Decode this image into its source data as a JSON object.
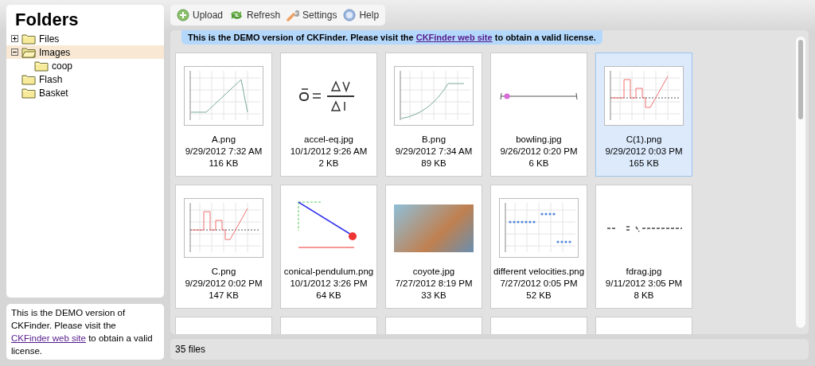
{
  "sidebar": {
    "title": "Folders",
    "folders": [
      {
        "name": "Files",
        "expanded": false,
        "selected": false
      },
      {
        "name": "Images",
        "expanded": true,
        "selected": true,
        "children": [
          {
            "name": "coop",
            "selected": false
          }
        ]
      },
      {
        "name": "Flash",
        "selected": false
      },
      {
        "name": "Basket",
        "selected": false
      }
    ],
    "license_notice": {
      "before": "This is the DEMO version of CKFinder. Please visit the ",
      "link": "CKFinder web site",
      "after": " to obtain a valid license."
    }
  },
  "toolbar": [
    {
      "label": "Upload"
    },
    {
      "label": "Refresh"
    },
    {
      "label": "Settings"
    },
    {
      "label": "Help"
    }
  ],
  "banner": {
    "before": "This is the DEMO version of CKFinder. Please visit the ",
    "link": "CKFinder web site",
    "after": " to obtain a valid license."
  },
  "files": [
    {
      "name": "A.png",
      "date": "9/29/2012 7:32 AM",
      "size": "116 KB",
      "kind": "line-chart",
      "selected": false
    },
    {
      "name": "accel-eq.jpg",
      "date": "10/1/2012 9:26 AM",
      "size": "2 KB",
      "kind": "equation",
      "selected": false
    },
    {
      "name": "B.png",
      "date": "9/29/2012 7:34 AM",
      "size": "89 KB",
      "kind": "curve-chart",
      "selected": false
    },
    {
      "name": "bowling.jpg",
      "date": "9/26/2012 0:20 PM",
      "size": "6 KB",
      "kind": "track",
      "selected": false
    },
    {
      "name": "C(1).png",
      "date": "9/29/2012 0:03 PM",
      "size": "165 KB",
      "kind": "step-chart",
      "selected": true
    },
    {
      "name": "C.png",
      "date": "9/29/2012 0:02 PM",
      "size": "147 KB",
      "kind": "step-chart",
      "selected": false
    },
    {
      "name": "conical-pendulum.png",
      "date": "10/1/2012 3:26 PM",
      "size": "64 KB",
      "kind": "pendulum",
      "selected": false
    },
    {
      "name": "coyote.jpg",
      "date": "7/27/2012 8:19 PM",
      "size": "33 KB",
      "kind": "photo",
      "selected": false
    },
    {
      "name": "different velocities.png",
      "date": "7/27/2012 0:05 PM",
      "size": "52 KB",
      "kind": "dot-chart",
      "selected": false
    },
    {
      "name": "fdrag.jpg",
      "date": "9/11/2012 3:05 PM",
      "size": "8 KB",
      "kind": "formula",
      "selected": false
    }
  ],
  "status_bar": {
    "count": "35 files"
  }
}
